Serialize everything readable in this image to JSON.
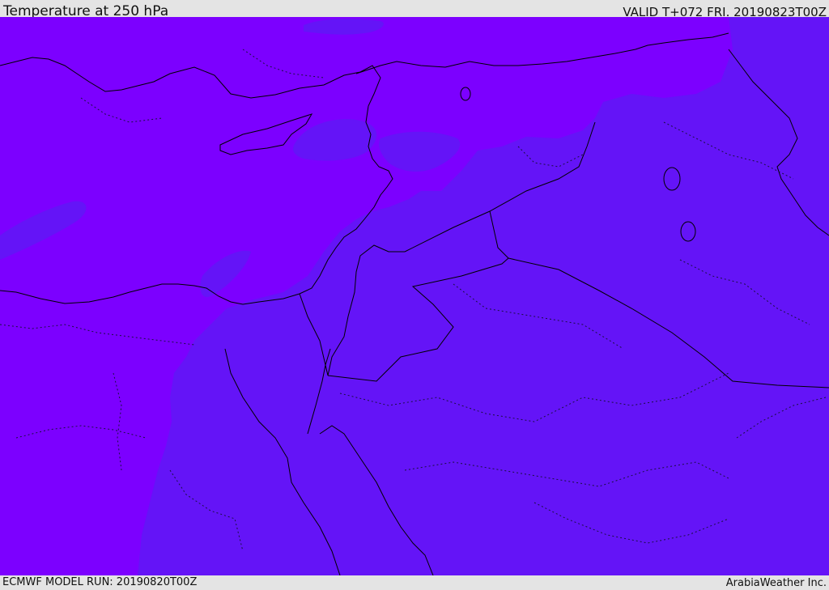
{
  "header": {
    "title": "Temperature at 250 hPa",
    "valid_time": "VALID T+072 FRI. 20190823T00Z"
  },
  "footer": {
    "model_run": "ECMWF MODEL RUN: 20190820T00Z",
    "credit": "ArabiaWeather Inc."
  },
  "map": {
    "field": "Temperature at 250 hPa",
    "colors": {
      "warmer_band": "#7c00ff",
      "cooler_band": "#6414f7",
      "coastline": "#000000",
      "borders": "#1a0f40"
    },
    "region": "Eastern Mediterranean / Middle East"
  }
}
